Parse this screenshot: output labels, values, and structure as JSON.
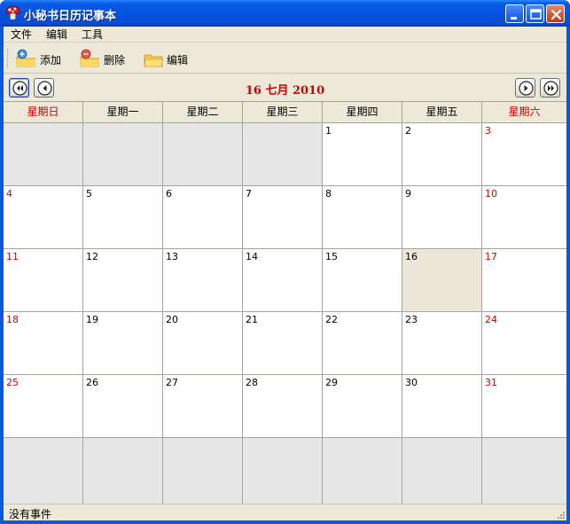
{
  "window": {
    "title": "小秘书日历记事本",
    "icon": "mushroom-app-icon",
    "controls": [
      "minimize-icon",
      "maximize-icon",
      "close-icon"
    ]
  },
  "menubar": {
    "items": [
      {
        "label": "文件"
      },
      {
        "label": "编辑"
      },
      {
        "label": "工具"
      }
    ]
  },
  "toolbar": {
    "add_label": "添加",
    "delete_label": "删除",
    "edit_label": "编辑",
    "add_icon": "folder-add-icon",
    "delete_icon": "folder-delete-icon",
    "edit_icon": "folder-icon"
  },
  "nav": {
    "date_title": "16  七月  2010",
    "prev_year_icon": "double-left-arrow-icon",
    "prev_month_icon": "left-arrow-icon",
    "next_month_icon": "right-arrow-icon",
    "next_year_icon": "double-right-arrow-icon"
  },
  "calendar": {
    "weekdays": [
      "星期日",
      "星期一",
      "星期二",
      "星期三",
      "星期四",
      "星期五",
      "星期六"
    ],
    "weeks": [
      [
        "",
        "",
        "",
        "",
        "1",
        "2",
        "3"
      ],
      [
        "4",
        "5",
        "6",
        "7",
        "8",
        "9",
        "10"
      ],
      [
        "11",
        "12",
        "13",
        "14",
        "15",
        "16",
        "17"
      ],
      [
        "18",
        "19",
        "20",
        "21",
        "22",
        "23",
        "24"
      ],
      [
        "25",
        "26",
        "27",
        "28",
        "29",
        "30",
        "31"
      ],
      [
        "",
        "",
        "",
        "",
        "",
        "",
        ""
      ]
    ],
    "selected_day": "16",
    "colors": {
      "weekend": "#cc0000",
      "empty_cell": "#e6e6e6",
      "selected_cell": "#ebe8da",
      "title_bar": "#0552dd"
    }
  },
  "status": {
    "text": "没有事件"
  }
}
